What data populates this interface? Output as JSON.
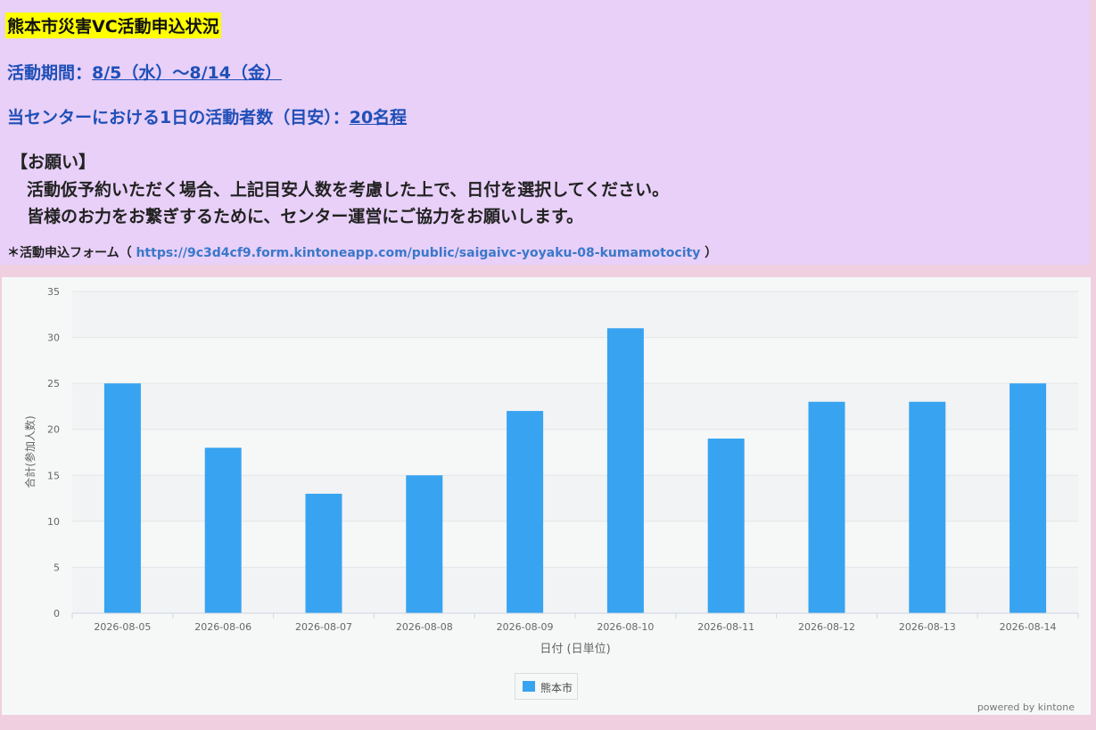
{
  "notice": {
    "title": "熊本市災害VC活動申込状況",
    "period_label": "活動期間：",
    "period_value": "8/5（水）～8/14（金）",
    "capacity_label": "当センターにおける1日の活動者数（目安）：",
    "capacity_value": "20名程",
    "request_heading": "【お願い】",
    "request_line1": "活動仮予約いただく場合、上記目安人数を考慮した上で、日付を選択してください。",
    "request_line2": "皆様のお力をお繋ぎするために、センター運営にご協力をお願いします。",
    "form_label": "＊活動申込フォーム（",
    "form_url": "https://9c3d4cf9.form.kintoneapp.com/public/saigaivc-yoyaku-08-kumamotocity",
    "form_close": "）"
  },
  "colors": {
    "bar": "#38a3f1",
    "title_highlight": "#ffff00",
    "notice_bg": "#e8d0f8",
    "link": "#1f4fb7"
  },
  "chart_data": {
    "type": "bar",
    "categories": [
      "2026-08-05",
      "2026-08-06",
      "2026-08-07",
      "2026-08-08",
      "2026-08-09",
      "2026-08-10",
      "2026-08-11",
      "2026-08-12",
      "2026-08-13",
      "2026-08-14"
    ],
    "series": [
      {
        "name": "熊本市",
        "values": [
          25,
          18,
          13,
          15,
          22,
          31,
          19,
          23,
          23,
          25
        ]
      }
    ],
    "xlabel": "日付 (日単位)",
    "ylabel": "合計(参加人数)",
    "ylim": [
      0,
      35
    ],
    "yticks": [
      0,
      5,
      10,
      15,
      20,
      25,
      30,
      35
    ],
    "legend": "bottom-center",
    "grid": true
  },
  "footer": {
    "powered": "powered by kintone"
  }
}
